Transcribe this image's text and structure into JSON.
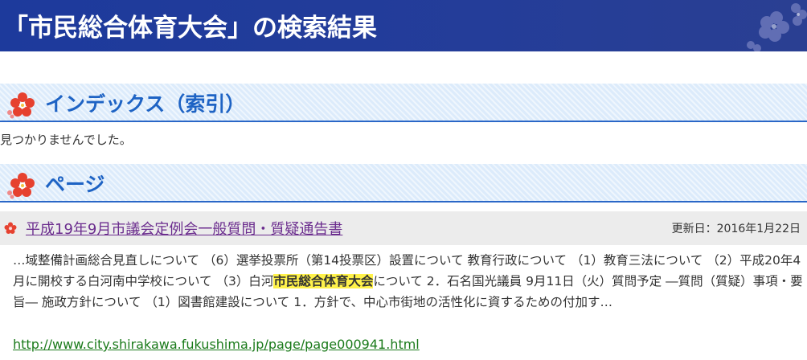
{
  "page": {
    "title": "「市民総合体育大会」の検索結果"
  },
  "index_section": {
    "heading": "インデックス（索引）",
    "no_result_text": "見つかりませんでした。"
  },
  "page_section": {
    "heading": "ページ"
  },
  "results": [
    {
      "title": "平成19年9月市議会定例会一般質問・質疑通告書",
      "updated": "更新日：2016年1月22日",
      "snippet_before": "…域整備計画総合見直しについて （6）選挙投票所（第14投票区）設置について 教育行政について （1）教育三法について （2）平成20年4月に開校する白河南中学校について （3）白河",
      "snippet_highlight": "市民総合体育大会",
      "snippet_after": "について 2．石名国光議員 9月11日（火）質問予定 ―質問（質疑）事項・要旨― 施政方針について （1）図書館建設について 1．方針で、中心市街地の活性化に資するための付加す…",
      "url": "http://www.city.shirakawa.fukushima.jp/page/page000941.html"
    }
  ],
  "icons": {
    "section_icon": "plum-blossom-icon",
    "result_bullet": "plum-flower-bullet-icon",
    "title_decoration": "plum-blossom-decoration"
  },
  "colors": {
    "title_bar": "#243d99",
    "section_heading": "#1e63c4",
    "section_border": "#2a67c7",
    "highlight": "#fff24a",
    "visited_link": "#6b2d8e",
    "url_green": "#1a7a1a"
  }
}
